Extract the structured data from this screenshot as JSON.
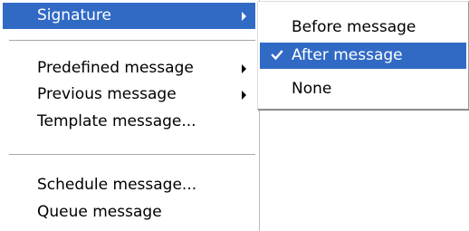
{
  "main_menu": {
    "items": [
      {
        "label": "Signature",
        "has_submenu": true,
        "selected": true
      },
      {
        "label": "Predefined message",
        "has_submenu": true
      },
      {
        "label": "Previous message",
        "has_submenu": true
      },
      {
        "label": "Template message..."
      },
      {
        "label": "Schedule message..."
      },
      {
        "label": "Queue message"
      }
    ]
  },
  "submenu": {
    "items": [
      {
        "label": "Before message"
      },
      {
        "label": "After message",
        "checked": true,
        "selected": true
      },
      {
        "label": "None"
      }
    ]
  },
  "icons": {
    "submenu_arrow": "triangle-right-icon",
    "check": "checkmark-icon"
  },
  "colors": {
    "highlight": "#316ac5",
    "highlight_text": "#ffffff",
    "text": "#000000",
    "separator": "#a8a8a8"
  }
}
